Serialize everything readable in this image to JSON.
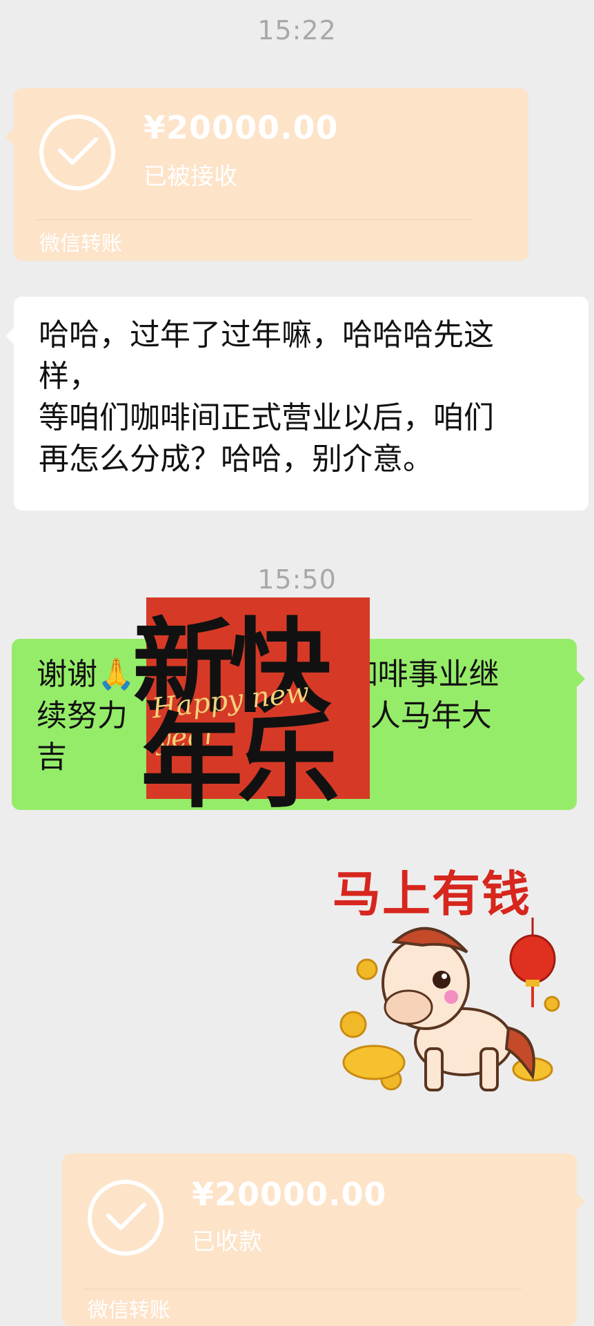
{
  "timestamps": {
    "first": "15:22",
    "second": "15:50"
  },
  "transfer_received": {
    "amount": "¥20000.00",
    "status": "已被接收",
    "source": "微信转账"
  },
  "message_left": {
    "text": "哈哈，过年了过年嘛，哈哈哈先这\n样，\n等咱们咖啡间正式营业以后，咱们\n再怎么分成？哈哈，别介意。"
  },
  "message_right": {
    "text": "谢谢🙏                      咖啡事业继\n续努力                      家人马年大\n吉"
  },
  "sticker_new_year": {
    "chars_top": "新快",
    "chars_bottom": "年乐",
    "script": "Happy new year"
  },
  "sticker_horse": {
    "title": "马上有钱"
  },
  "transfer_sent": {
    "amount": "¥20000.00",
    "status": "已收款",
    "source": "微信转账"
  },
  "colors": {
    "background": "#ededed",
    "transfer_bubble": "#fde3c8",
    "text_bubble": "#ffffff",
    "sent_bubble": "#95ec69",
    "sticker_red": "#d63a26"
  }
}
